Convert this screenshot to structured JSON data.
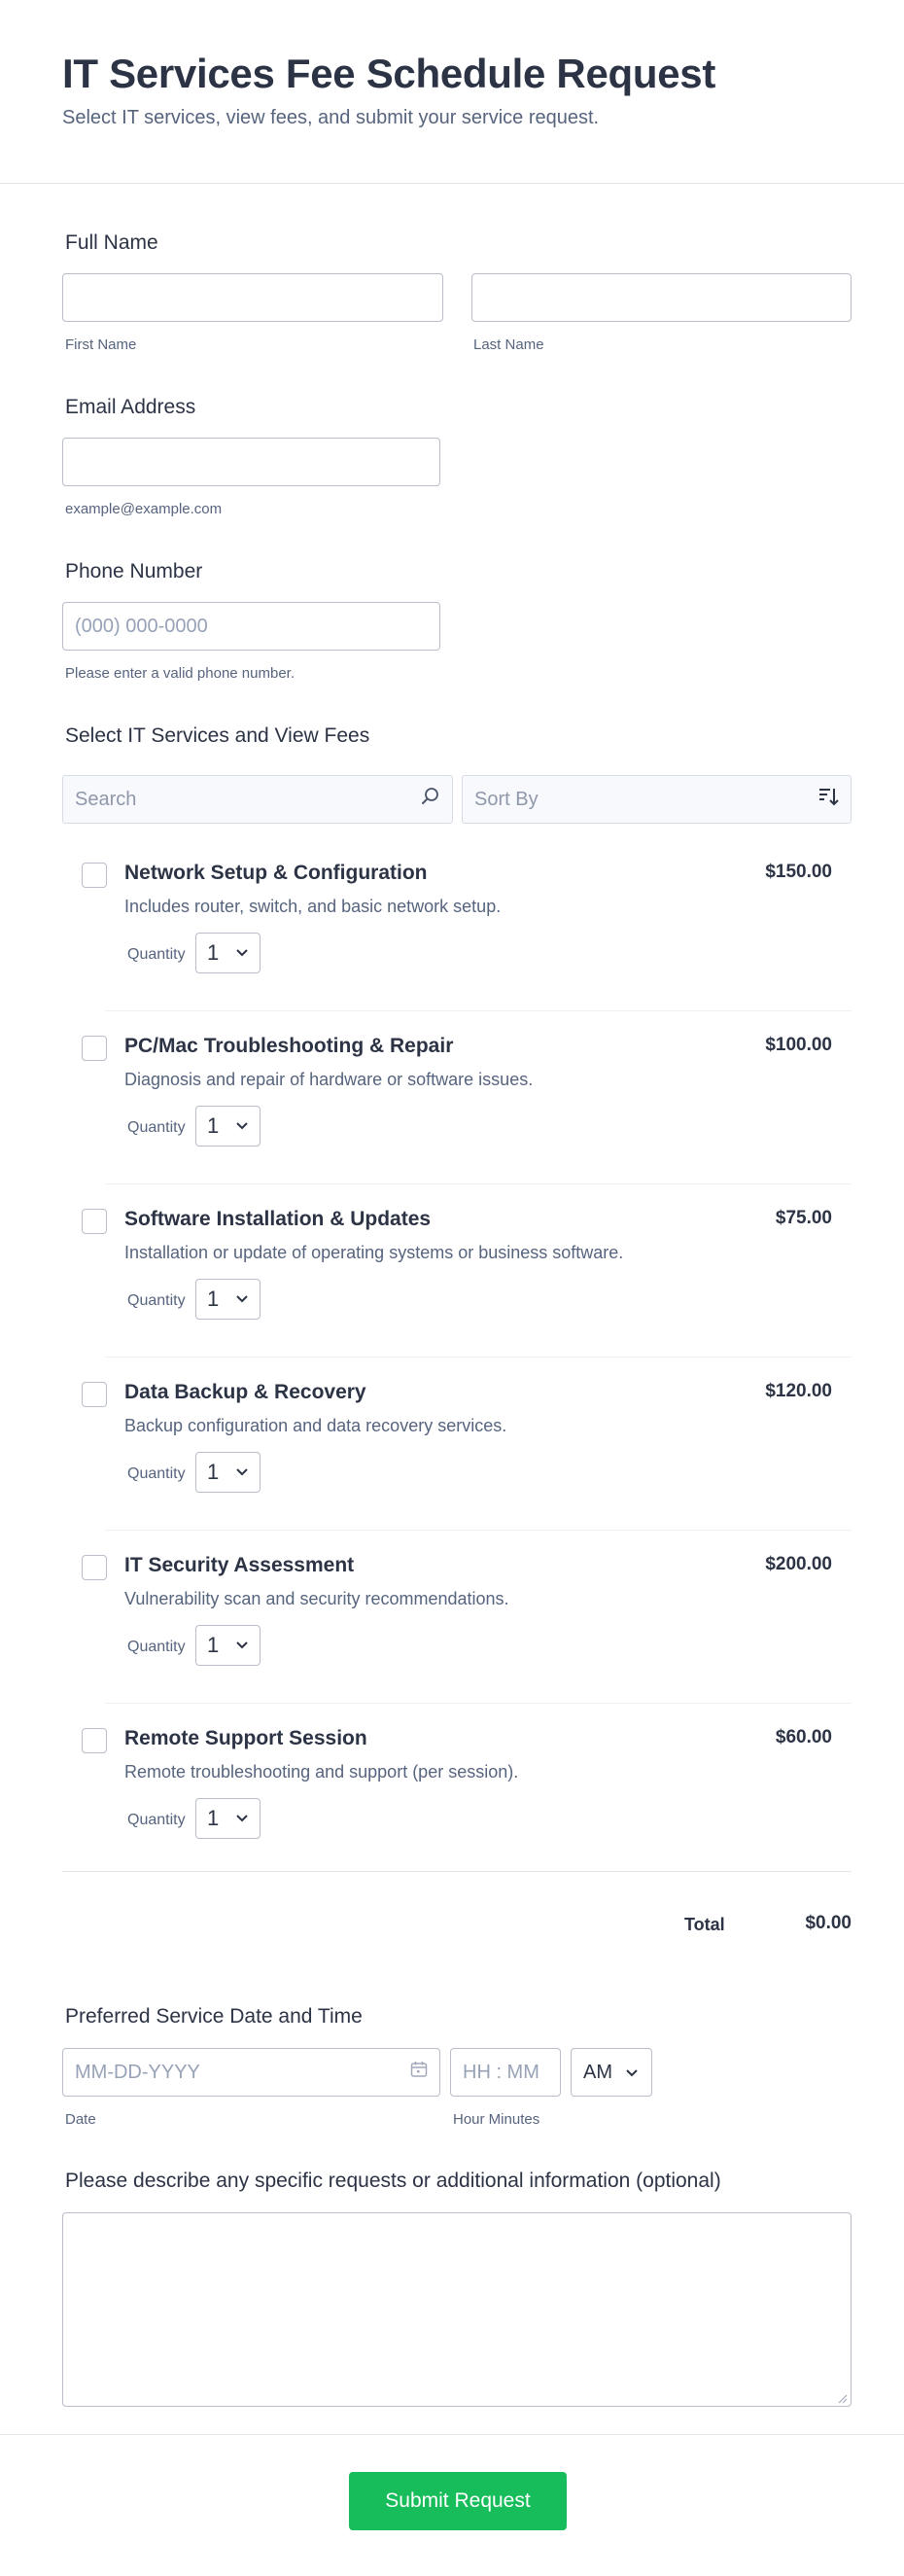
{
  "header": {
    "title": "IT Services Fee Schedule Request",
    "subtitle": "Select IT services, view fees, and submit your service request."
  },
  "full_name": {
    "label": "Full Name",
    "first_value": "",
    "last_value": "",
    "first_sublabel": "First Name",
    "last_sublabel": "Last Name"
  },
  "email": {
    "label": "Email Address",
    "value": "",
    "sublabel": "example@example.com"
  },
  "phone": {
    "label": "Phone Number",
    "placeholder": "(000) 000-0000",
    "sublabel": "Please enter a valid phone number."
  },
  "services": {
    "label": "Select IT Services and View Fees",
    "search_placeholder": "Search",
    "sort_placeholder": "Sort By",
    "quantity_label": "Quantity",
    "items": [
      {
        "name": "Network Setup & Configuration",
        "price": "$150.00",
        "description": "Includes router, switch, and basic network setup.",
        "quantity": "1",
        "checked": false
      },
      {
        "name": "PC/Mac Troubleshooting & Repair",
        "price": "$100.00",
        "description": "Diagnosis and repair of hardware or software issues.",
        "quantity": "1",
        "checked": false
      },
      {
        "name": "Software Installation & Updates",
        "price": "$75.00",
        "description": "Installation or update of operating systems or business software.",
        "quantity": "1",
        "checked": false
      },
      {
        "name": "Data Backup & Recovery",
        "price": "$120.00",
        "description": "Backup configuration and data recovery services.",
        "quantity": "1",
        "checked": false
      },
      {
        "name": "IT Security Assessment",
        "price": "$200.00",
        "description": "Vulnerability scan and security recommendations.",
        "quantity": "1",
        "checked": false
      },
      {
        "name": "Remote Support Session",
        "price": "$60.00",
        "description": "Remote troubleshooting and support (per session).",
        "quantity": "1",
        "checked": false
      }
    ],
    "total_label": "Total",
    "total_value": "$0.00"
  },
  "schedule": {
    "label": "Preferred Service Date and Time",
    "date_placeholder": "MM-DD-YYYY",
    "time_placeholder": "HH : MM",
    "ampm_value": "AM",
    "date_sublabel": "Date",
    "time_sublabel": "Hour Minutes"
  },
  "details": {
    "label": "Please describe any specific requests or additional information (optional)",
    "value": ""
  },
  "submit": {
    "label": "Submit Request",
    "color": "#18bd5b"
  },
  "icons": {
    "search": "search-icon",
    "sort": "sort-descending-icon",
    "calendar": "calendar-icon",
    "chevron": "chevron-down-icon"
  }
}
